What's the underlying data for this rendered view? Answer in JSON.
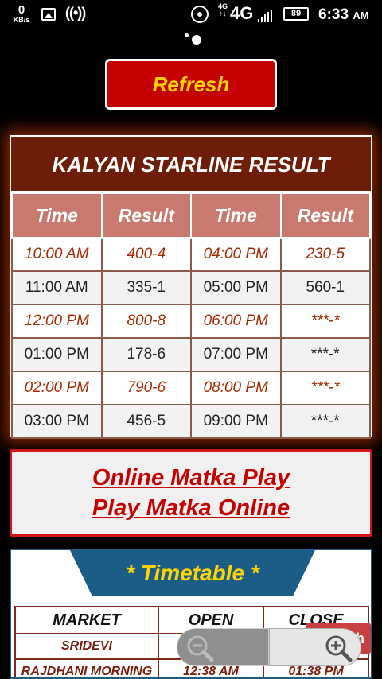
{
  "status_bar": {
    "speed_value": "0",
    "speed_unit": "KB/s",
    "network_small_top": "4G",
    "network_small_bottom": "↑↓",
    "network": "4G",
    "battery": "89",
    "time": "6:33",
    "ampm": "AM"
  },
  "refresh_button": {
    "label": "Refresh"
  },
  "result": {
    "title": "KALYAN STARLINE RESULT",
    "headers": [
      "Time",
      "Result",
      "Time",
      "Result"
    ],
    "rows": [
      [
        "10:00 AM",
        "400-4",
        "04:00 PM",
        "230-5"
      ],
      [
        "11:00 AM",
        "335-1",
        "05:00 PM",
        "560-1"
      ],
      [
        "12:00 PM",
        "800-8",
        "06:00 PM",
        "***-*"
      ],
      [
        "01:00 PM",
        "178-6",
        "07:00 PM",
        "***-*"
      ],
      [
        "02:00 PM",
        "790-6",
        "08:00 PM",
        "***-*"
      ],
      [
        "03:00 PM",
        "456-5",
        "09:00 PM",
        "***-*"
      ]
    ]
  },
  "matka_links": {
    "link1": "Online Matka Play",
    "link2": "Play Matka Online"
  },
  "timetable": {
    "title": "* Timetable *",
    "headers": [
      "MARKET",
      "OPEN",
      "CLOSE"
    ],
    "rows": [
      [
        "SRIDEVI",
        "",
        ""
      ],
      [
        "RAJDHANI MORNING",
        "12:38 AM",
        "01:38 PM"
      ]
    ]
  },
  "peek_button": {
    "label": "h"
  },
  "colors": {
    "title_bg": "#6e1d08",
    "header_bg": "#c87a70",
    "accent_red": "#c40000",
    "accent_yellow": "#ffd400",
    "timetable_blue": "#1c5d87"
  }
}
